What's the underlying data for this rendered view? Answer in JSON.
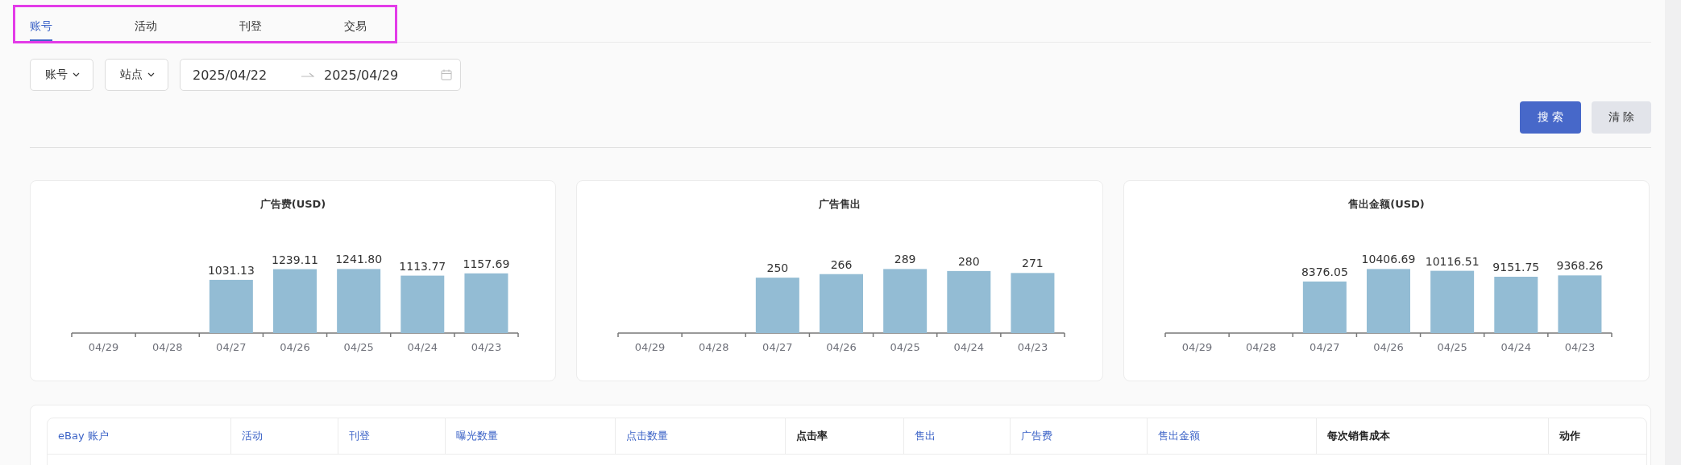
{
  "tabs": {
    "highlighted": true,
    "items": [
      {
        "label": "账号",
        "selected": true
      },
      {
        "label": "活动",
        "selected": false
      },
      {
        "label": "刊登",
        "selected": false
      },
      {
        "label": "交易",
        "selected": false
      }
    ]
  },
  "filters": {
    "dropdowns": [
      "账号",
      "站点"
    ],
    "date_range": {
      "start": "2025/04/22",
      "end": "2025/04/29"
    }
  },
  "buttons": [
    {
      "label": "搜 索",
      "kind": "primary"
    },
    {
      "label": "清 除",
      "kind": "secondary"
    }
  ],
  "charts": [
    {
      "title": "广告费(USD)",
      "chart_data": {
        "type": "bar",
        "categories": [
          "04/29",
          "04/28",
          "04/27",
          "04/26",
          "04/25",
          "04/24",
          "04/23"
        ],
        "values": [
          null,
          null,
          1031.13,
          1239.11,
          1241.8,
          1113.77,
          1157.69
        ],
        "value_labels": [
          null,
          null,
          "1031.13",
          "1239.11",
          "1241.80",
          "1113.77",
          "1157.69"
        ],
        "data_labels": true
      }
    },
    {
      "title": "广告售出",
      "chart_data": {
        "type": "bar",
        "categories": [
          "04/29",
          "04/28",
          "04/27",
          "04/26",
          "04/25",
          "04/24",
          "04/23"
        ],
        "values": [
          null,
          null,
          250,
          266,
          289,
          280,
          271
        ],
        "value_labels": [
          null,
          null,
          "250",
          "266",
          "289",
          "280",
          "271"
        ],
        "data_labels": true
      }
    },
    {
      "title": "售出金额(USD)",
      "chart_data": {
        "type": "bar",
        "categories": [
          "04/29",
          "04/28",
          "04/27",
          "04/26",
          "04/25",
          "04/24",
          "04/23"
        ],
        "values": [
          null,
          null,
          8376.05,
          10406.69,
          10116.51,
          9151.75,
          9368.26
        ],
        "value_labels": [
          null,
          null,
          "8376.05",
          "10406.69",
          "10116.51",
          "9151.75",
          "9368.26"
        ],
        "data_labels": true
      }
    }
  ],
  "table": {
    "columns": [
      {
        "label": "eBay 账户",
        "kind": "sortable"
      },
      {
        "label": "活动",
        "kind": "sortable"
      },
      {
        "label": "刊登",
        "kind": "sortable"
      },
      {
        "label": "曝光数量",
        "kind": "sortable"
      },
      {
        "label": "点击数量",
        "kind": "sortable"
      },
      {
        "label": "点击率",
        "kind": "plain"
      },
      {
        "label": "售出",
        "kind": "sortable"
      },
      {
        "label": "广告费",
        "kind": "sortable"
      },
      {
        "label": "售出金额",
        "kind": "sortable"
      },
      {
        "label": "每次销售成本",
        "kind": "plain"
      },
      {
        "label": "动作",
        "kind": "plain"
      }
    ]
  }
}
